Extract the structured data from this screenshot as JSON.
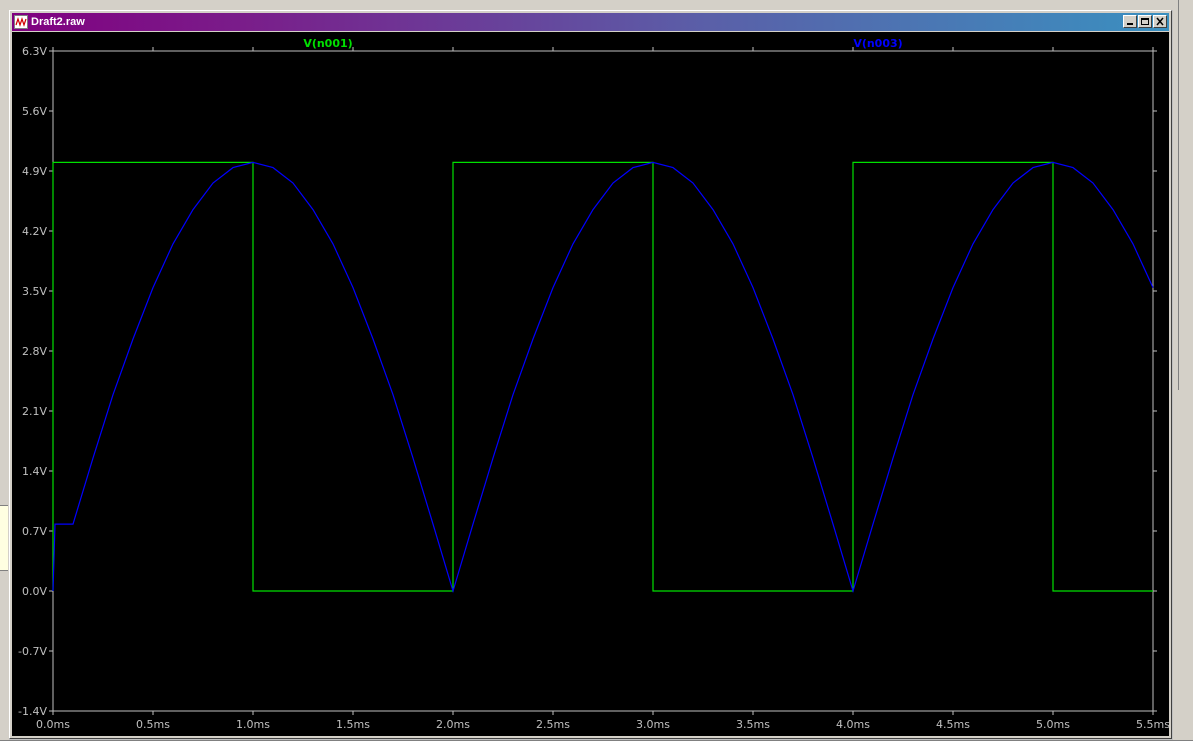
{
  "window": {
    "title": "Draft2.raw",
    "minimize_icon": "minimize-icon",
    "restore_icon": "restore-icon",
    "close_icon": "close-icon"
  },
  "colors": {
    "plot_background": "#000000",
    "frame": "#c0c0c0",
    "series1": "#00e000",
    "series2": "#0000ff"
  },
  "chart_data": {
    "type": "line",
    "xlabel": "",
    "ylabel": "",
    "xlim": [
      0,
      5.5
    ],
    "ylim": [
      -1.4,
      6.3
    ],
    "x_ticks": [
      "0.0ms",
      "0.5ms",
      "1.0ms",
      "1.5ms",
      "2.0ms",
      "2.5ms",
      "3.0ms",
      "3.5ms",
      "4.0ms",
      "4.5ms",
      "5.0ms",
      "5.5ms"
    ],
    "y_ticks": [
      "6.3V",
      "5.6V",
      "4.9V",
      "4.2V",
      "3.5V",
      "2.8V",
      "2.1V",
      "1.4V",
      "0.7V",
      "0.0V",
      "-0.7V",
      "-1.4V"
    ],
    "grid": false,
    "legend": "top",
    "series": [
      {
        "name": "V(n001)",
        "color": "#00e000",
        "x": [
          0,
          0,
          1.0,
          1.0,
          2.0,
          2.0,
          3.0,
          3.0,
          4.0,
          4.0,
          5.0,
          5.0,
          5.5
        ],
        "y": [
          0,
          5.0,
          5.0,
          0,
          0,
          5.0,
          5.0,
          0,
          0,
          5.0,
          5.0,
          0,
          0
        ]
      },
      {
        "name": "V(n003)",
        "color": "#0000ff",
        "x": [
          0,
          0.01,
          0.1,
          0.2,
          0.3,
          0.4,
          0.5,
          0.6,
          0.7,
          0.8,
          0.9,
          1.0,
          1.1,
          1.2,
          1.3,
          1.4,
          1.5,
          1.6,
          1.7,
          1.8,
          1.9,
          2.0,
          2.1,
          2.2,
          2.3,
          2.4,
          2.5,
          2.6,
          2.7,
          2.8,
          2.9,
          3.0,
          3.1,
          3.2,
          3.3,
          3.4,
          3.5,
          3.6,
          3.7,
          3.8,
          3.9,
          4.0,
          4.1,
          4.2,
          4.3,
          4.4,
          4.5,
          4.6,
          4.7,
          4.8,
          4.9,
          5.0,
          5.1,
          5.2,
          5.3,
          5.4,
          5.5
        ],
        "y": [
          0.0,
          0.78,
          0.78,
          1.55,
          2.29,
          2.94,
          3.54,
          4.05,
          4.45,
          4.76,
          4.94,
          5.0,
          4.94,
          4.76,
          4.45,
          4.05,
          3.54,
          2.94,
          2.29,
          1.55,
          0.78,
          0.0,
          0.78,
          1.55,
          2.29,
          2.94,
          3.54,
          4.05,
          4.45,
          4.76,
          4.94,
          5.0,
          4.94,
          4.76,
          4.45,
          4.05,
          3.54,
          2.94,
          2.29,
          1.55,
          0.78,
          0.0,
          0.78,
          1.55,
          2.29,
          2.94,
          3.54,
          4.05,
          4.45,
          4.76,
          4.94,
          5.0,
          4.94,
          4.76,
          4.45,
          4.05,
          3.54
        ]
      }
    ]
  }
}
